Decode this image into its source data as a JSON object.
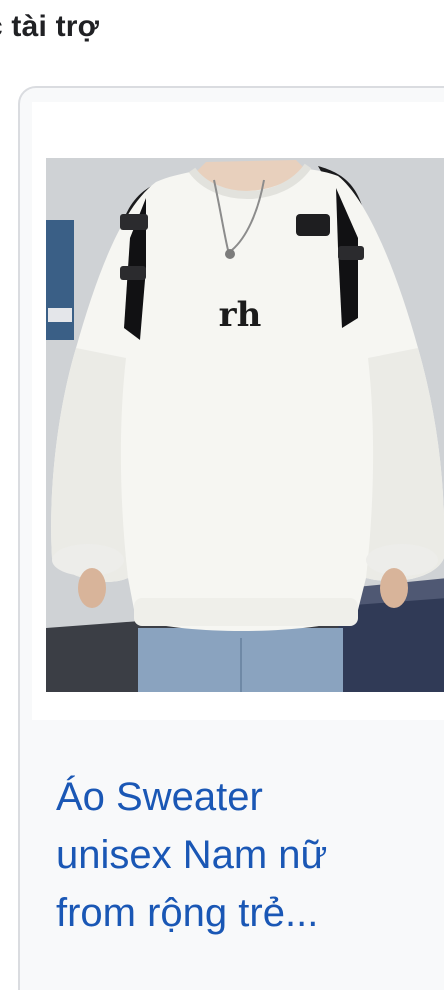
{
  "section": {
    "title": "c tài trợ"
  },
  "product": {
    "image_print": "rh",
    "title": "Áo Sweater\nunisex Nam nữ\nfrom rộng trẻ..."
  },
  "colors": {
    "title_link": "#1a57b5",
    "card_border": "#dadce0",
    "card_bg": "#f8f9fa"
  }
}
